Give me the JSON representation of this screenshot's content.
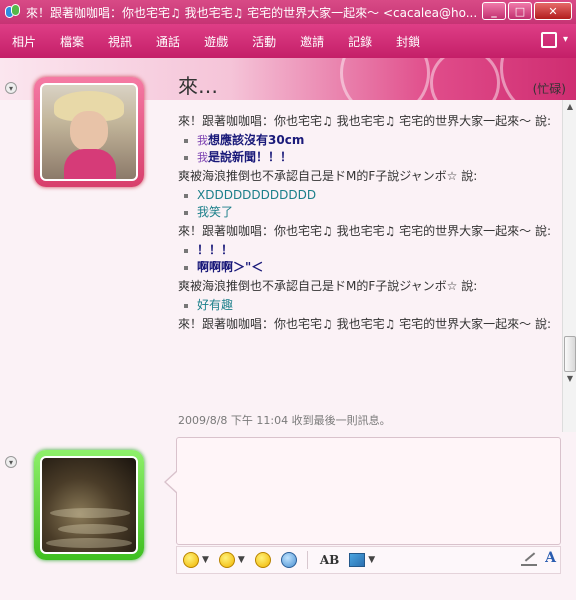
{
  "window": {
    "title": "來！跟著咖咖唱：你也宅宅♫ 我也宅宅♫ 宅宅的世界大家一起來～ <cacalea@ho...",
    "min": "_",
    "max": "□",
    "close": "✕"
  },
  "menu": {
    "items": [
      "相片",
      "檔案",
      "視訊",
      "通話",
      "遊戲",
      "活動",
      "邀請",
      "記錄",
      "封鎖"
    ],
    "more_caret": "▾"
  },
  "contact": {
    "name": "來…",
    "status": "(忙碌)"
  },
  "conversation": [
    {
      "header": "來！跟著咖咖唱：你也宅宅♫ 我也宅宅♫ 宅宅的世界大家一起來～ 說:",
      "lines": [
        {
          "emote": "我",
          "text": "想應該沒有30cm",
          "style": "navy"
        },
        {
          "emote": "我",
          "text": "是說新聞！！！",
          "style": "navy"
        }
      ]
    },
    {
      "header": "爽被海浪推倒也不承認自己是ドM的F子說ジャンボ☆ 說:",
      "lines": [
        {
          "text": "XDDDDDDDDDDDD",
          "style": "teal"
        },
        {
          "text": "我笑了",
          "style": "teal"
        }
      ]
    },
    {
      "header": "來！跟著咖咖唱：你也宅宅♫ 我也宅宅♫ 宅宅的世界大家一起來～ 說:",
      "lines": [
        {
          "text": "！！！",
          "style": "navy"
        },
        {
          "text": "啊啊啊＞\"＜",
          "style": "navy"
        }
      ]
    },
    {
      "header": "爽被海浪推倒也不承認自己是ドM的F子說ジャンボ☆ 說:",
      "lines": [
        {
          "text": "好有趣",
          "style": "teal"
        }
      ]
    },
    {
      "header": "來！跟著咖咖唱：你也宅宅♫ 我也宅宅♫ 宅宅的世界大家一起來～ 說:",
      "lines": []
    }
  ],
  "status_line": "2009/8/8 下午 11:04 收到最後一則訊息。",
  "toolbar": {
    "font_label": "AB",
    "font_a": "A"
  },
  "colors": {
    "accent": "#c41f68",
    "navy_text": "#1a1a7a",
    "teal_text": "#1b7f8a"
  }
}
